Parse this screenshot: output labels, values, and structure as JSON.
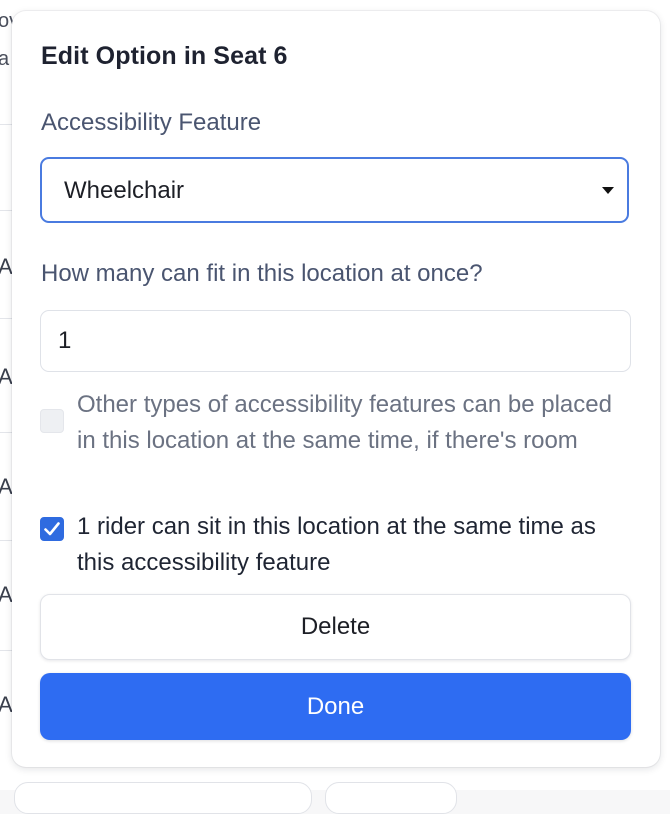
{
  "background": {
    "partial_top_line1": "ov",
    "partial_top_line2": "a",
    "row_letters": [
      "A",
      "A",
      "A",
      "A",
      "A"
    ]
  },
  "modal": {
    "title": "Edit Option in Seat 6",
    "feature_label": "Accessibility Feature",
    "feature_select": {
      "value": "Wheelchair"
    },
    "capacity_label": "How many can fit in this location at once?",
    "capacity_input": {
      "value": "1"
    },
    "other_types_option": {
      "label": "Other types of accessibility features can be placed in this location at the same time, if there's room",
      "checked": false,
      "disabled": true
    },
    "rider_option": {
      "label": "1 rider can sit in this location at the same time as this accessibility feature",
      "checked": true
    },
    "delete_label": "Delete",
    "done_label": "Done"
  },
  "colors": {
    "accent": "#2e6cf2",
    "select_focus_border": "#4a7be0",
    "label_text": "#4a5570",
    "muted_text": "#6b7282"
  }
}
